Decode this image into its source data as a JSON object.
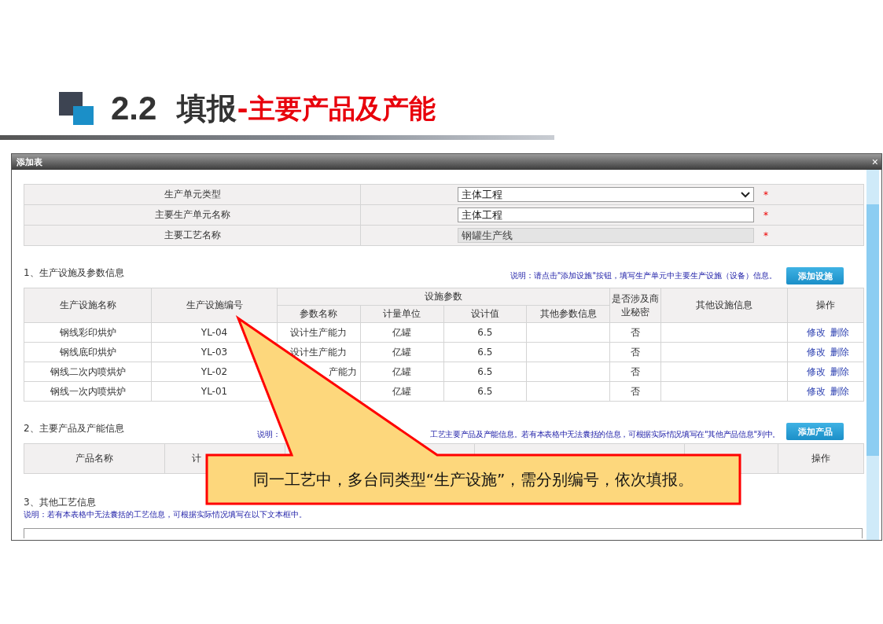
{
  "slide": {
    "number": "2.2",
    "title": "填报",
    "subtitle": "-主要产品及产能"
  },
  "dialog": {
    "title": "添加表",
    "close": "×"
  },
  "form": [
    {
      "label": "生产单元类型",
      "kind": "select",
      "value": "主体工程",
      "disabled": false,
      "required": "*"
    },
    {
      "label": "主要生产单元名称",
      "kind": "text",
      "value": "主体工程",
      "disabled": false,
      "required": "*"
    },
    {
      "label": "主要工艺名称",
      "kind": "text",
      "value": "钢罐生产线",
      "disabled": true,
      "required": "*"
    }
  ],
  "facilities": {
    "heading": "1、生产设施及参数信息",
    "note": "说明：请点击\"添加设施\"按钮，填写生产单元中主要生产设施（设备）信息。",
    "button": "添加设施",
    "header_rows": [
      [
        "生产设施名称",
        "生产设施编号",
        "设施参数",
        "是否涉及商业秘密",
        "其他设施信息",
        "操作"
      ],
      [
        "参数名称",
        "计量单位",
        "设计值",
        "其他参数信息"
      ]
    ],
    "rows": [
      [
        "钢线彩印烘炉",
        "YL-04",
        "设计生产能力",
        "亿罐",
        "6.5",
        null,
        "否",
        null,
        [
          "修改",
          "删除"
        ]
      ],
      [
        "钢线底印烘炉",
        "YL-03",
        "设计生产能力",
        "亿罐",
        "6.5",
        null,
        "否",
        null,
        [
          "修改",
          "删除"
        ]
      ],
      [
        "钢线二次内喷烘炉",
        "YL-02",
        "产能力",
        "亿罐",
        "6.5",
        null,
        "否",
        null,
        [
          "修改",
          "删除"
        ]
      ],
      [
        "钢线一次内喷烘炉",
        "YL-01",
        null,
        "亿罐",
        "6.5",
        null,
        "否",
        null,
        [
          "修改",
          "删除"
        ]
      ]
    ]
  },
  "products": {
    "heading": "2、主要产品及产能信息",
    "note_start": "说明：",
    "note_end": "工艺主要产品及产能信息。若有本表格中无法囊括的信息，可根据实际情况填写在\"其他产品信息\"列中。",
    "button": "添加产品",
    "columns": [
      "产品名称",
      "计",
      null,
      null,
      null,
      null,
      "操作"
    ]
  },
  "other": {
    "heading": "3、其他工艺信息",
    "note": "说明：若有本表格中无法囊括的工艺信息，可根据实际情况填写在以下文本框中。"
  },
  "callout": "同一工艺中，多台同类型“生产设施”，需分别编号，依次填报。"
}
